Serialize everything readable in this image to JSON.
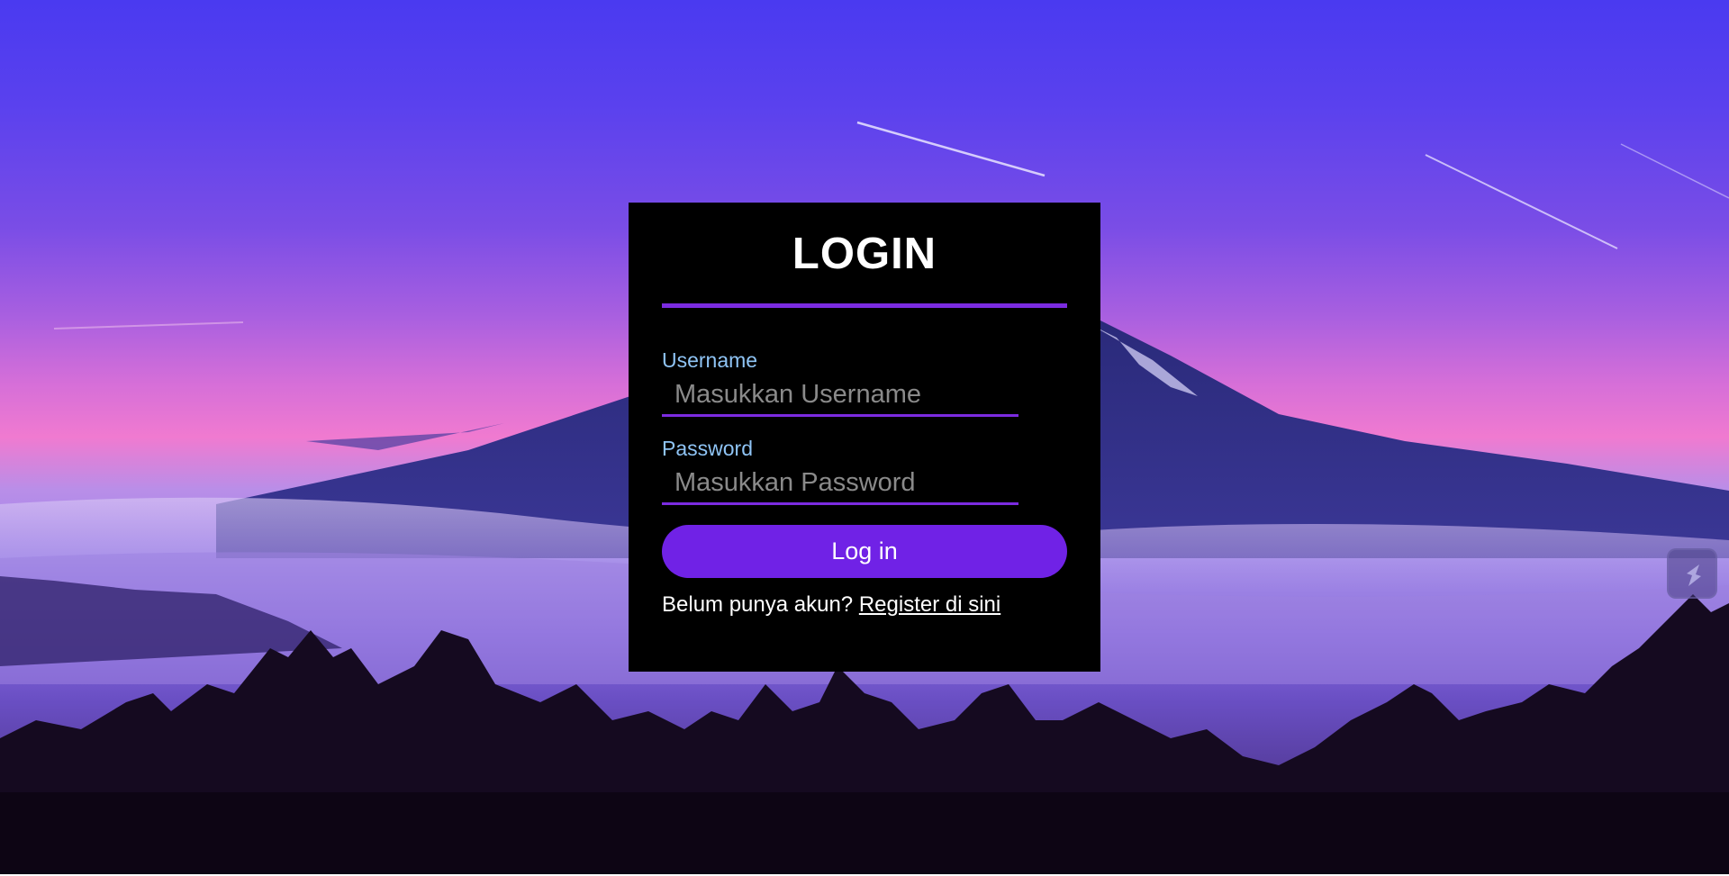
{
  "login": {
    "title": "LOGIN",
    "username_label": "Username",
    "username_placeholder": "Masukkan Username",
    "username_value": "",
    "password_label": "Password",
    "password_placeholder": "Masukkan Password",
    "password_value": "",
    "submit_label": "Log in",
    "register_prompt": "Belum punya akun?",
    "register_link": "Register di sini"
  },
  "background": {
    "description_icon": "mountain-landscape-image"
  },
  "widget": {
    "icon": "extension-icon"
  },
  "colors": {
    "accent": "#7b2be0",
    "button": "#7022e6",
    "label": "#8fc4f5",
    "card": "#000000"
  }
}
